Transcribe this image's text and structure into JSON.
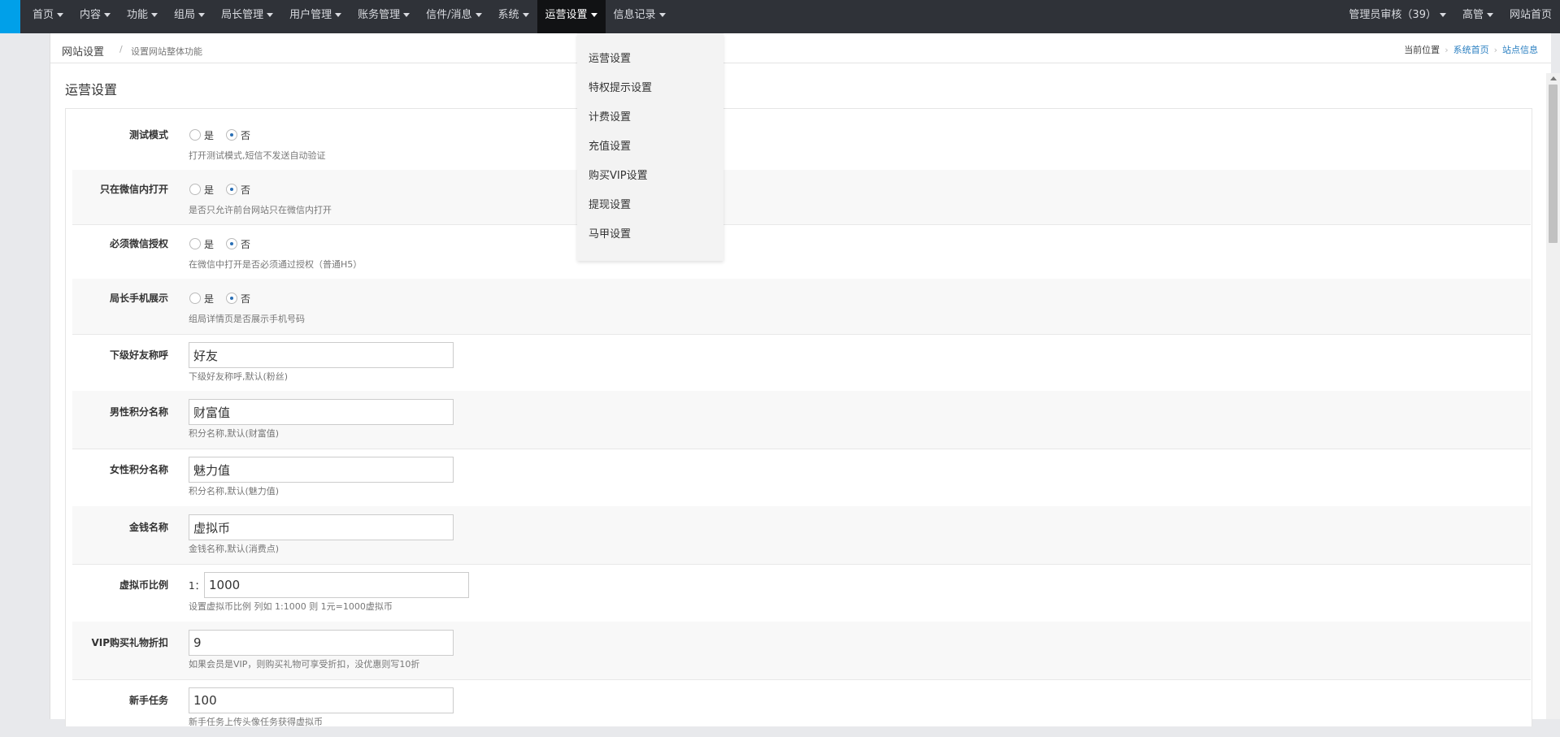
{
  "nav": {
    "left": [
      "首页",
      "内容",
      "功能",
      "组局",
      "局长管理",
      "用户管理",
      "账务管理",
      "信件/消息",
      "系统",
      "运营设置",
      "信息记录"
    ],
    "right": [
      "管理员审核（39）",
      "高管",
      "网站首页"
    ]
  },
  "dropdown": [
    "运营设置",
    "特权提示设置",
    "计费设置",
    "充值设置",
    "购买VIP设置",
    "提现设置",
    "马甲设置"
  ],
  "breadcrumb": {
    "title": "网站设置",
    "separator": "/",
    "subtitle": "设置网站整体功能",
    "location_label": "当前位置",
    "links": [
      "系统首页",
      "站点信息"
    ]
  },
  "section_title": "运营设置",
  "radio_labels": {
    "yes": "是",
    "no": "否"
  },
  "rows": [
    {
      "label": "测试模式",
      "hint": "打开测试模式,短信不发送自动验证"
    },
    {
      "label": "只在微信内打开",
      "hint": "是否只允许前台网站只在微信内打开"
    },
    {
      "label": "必须微信授权",
      "hint": "在微信中打开是否必须通过授权（普通H5）"
    },
    {
      "label": "局长手机展示",
      "hint": "组局详情页是否展示手机号码"
    },
    {
      "label": "下级好友称呼",
      "value": "好友",
      "hint": "下级好友称呼,默认(粉丝)"
    },
    {
      "label": "男性积分名称",
      "value": "财富值",
      "hint": "积分名称,默认(财富值)"
    },
    {
      "label": "女性积分名称",
      "value": "魅力值",
      "hint": "积分名称,默认(魅力值)"
    },
    {
      "label": "金钱名称",
      "value": "虚拟币",
      "hint": "金钱名称,默认(消费点)"
    },
    {
      "label": "虚拟币比例",
      "prefix": "1：",
      "value": "1000",
      "hint": "设置虚拟币比例 列如 1:1000 则 1元=1000虚拟币"
    },
    {
      "label": "VIP购买礼物折扣",
      "value": "9",
      "hint": "如果会员是VIP，则购买礼物可享受折扣，没优惠则写10折"
    },
    {
      "label": "新手任务",
      "value": "100",
      "hint": "新手任务上传头像任务获得虚拟币"
    }
  ],
  "colors": {
    "topbar": "#2f3238",
    "accent": "#00a0e9",
    "link": "#2a7fc1"
  }
}
